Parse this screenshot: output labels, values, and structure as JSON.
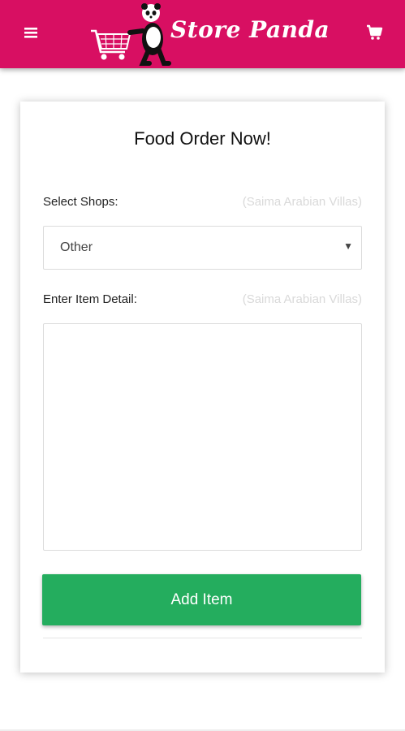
{
  "header": {
    "brand": "Store Panda",
    "background_color": "#d80f62",
    "menu_icon": "hamburger-menu-icon",
    "cart_icon": "shopping-cart-icon"
  },
  "form": {
    "title": "Food Order Now!",
    "shop_label": "Select Shops:",
    "shop_hint": "(Saima Arabian Villas)",
    "shop_selected": "Other",
    "item_label": "Enter Item Detail:",
    "item_hint": "(Saima Arabian Villas)",
    "item_value": "",
    "add_button_label": "Add Item",
    "add_button_color": "#24ad5e"
  }
}
